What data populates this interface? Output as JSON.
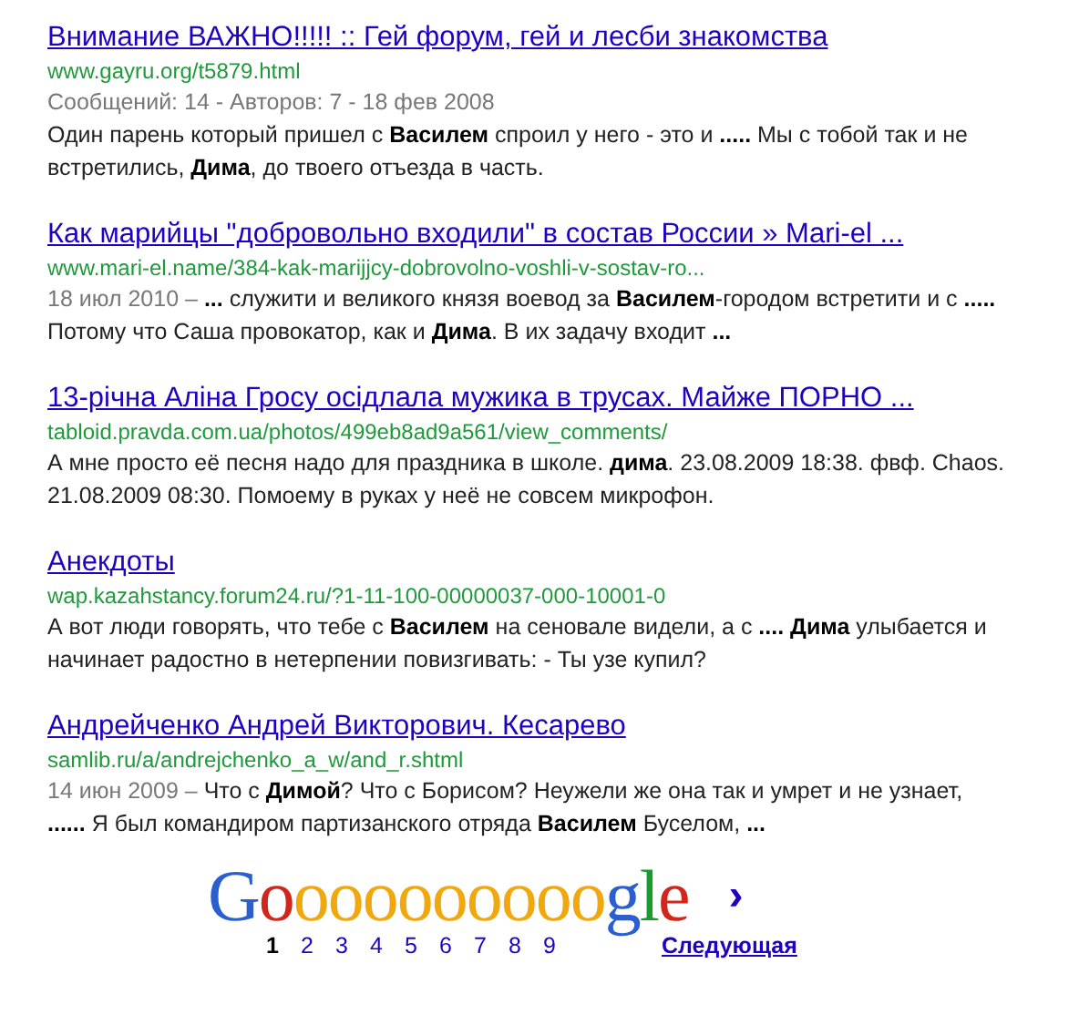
{
  "results": [
    {
      "title": "Внимание ВАЖНО!!!!! :: Гей форум, гей и лесби знакомства",
      "url": "www.gayru.org/t5879.html",
      "meta": "Сообщений: 14 - Авторов: 7 - 18 фев 2008",
      "snippet": "Один парень который пришел с **Василем** спроил у него - это и **.....** Мы с тобой так и не встретились, **Дима**, до твоего отъезда в часть."
    },
    {
      "title": "Как марийцы \"добровольно входили\" в состав России » Mari-el ...",
      "url": "www.mari-el.name/384-kak-marijjcy-dobrovolno-voshli-v-sostav-ro...",
      "date": "18 июл 2010 –",
      "snippet": "**...** служити и великого князя воевод за **Василем**-городом встретити и с **.....** Потому что Саша провокатор, как и **Дима**. В их задачу входит **...**"
    },
    {
      "title": "13-річна Аліна Гросу осідлала мужика в трусах. Майже ПОРНО ...",
      "url": "tabloid.pravda.com.ua/photos/499eb8ad9a561/view_comments/",
      "snippet": "А мне просто её песня надо для праздника в школе. **дима**. 23.08.2009 18:38. фвф. Chaos. 21.08.2009 08:30. Помоему в руках у неё не совсем микрофон."
    },
    {
      "title": "Анекдоты",
      "url": "wap.kazahstancy.forum24.ru/?1-11-100-00000037-000-10001-0",
      "snippet": "А вот люди говорять, что тебе с **Василем** на сеновале видели, а с **.... Дима** улыбается и начинает радостно в нетерпении повизгивать: - Ты узе купил?"
    },
    {
      "title": "Андрейченко Андрей Викторович. Кесарево",
      "url": "samlib.ru/a/andrejchenko_a_w/and_r.shtml",
      "date": "14 июн 2009 –",
      "snippet": "Что с **Димой**? Что с Борисом? Неужели же она так и умрет и не узнает, **......** Я был командиром партизанского отряда **Василем** Буселом, **...**"
    }
  ],
  "pagination": {
    "logo": "Goooooooooogle",
    "next_arrow": "›",
    "pages": [
      {
        "label": "1",
        "selected": true
      },
      {
        "label": "2",
        "selected": false
      },
      {
        "label": "3",
        "selected": false
      },
      {
        "label": "4",
        "selected": false
      },
      {
        "label": "5",
        "selected": false
      },
      {
        "label": "6",
        "selected": false
      },
      {
        "label": "7",
        "selected": false
      },
      {
        "label": "8",
        "selected": false
      },
      {
        "label": "9",
        "selected": false
      }
    ],
    "next": "Следующая"
  }
}
